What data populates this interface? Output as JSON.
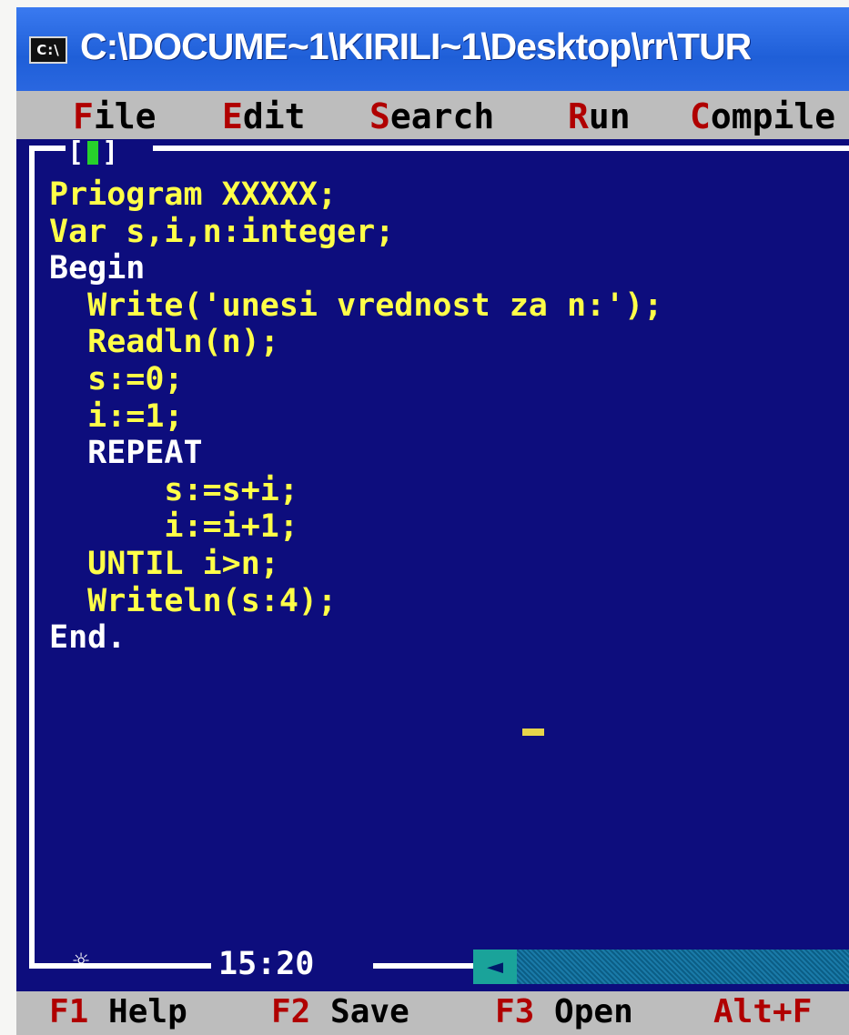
{
  "window": {
    "title": "C:\\DOCUME~1\\KIRILI~1\\Desktop\\rr\\TUR",
    "icon_text": "C:\\"
  },
  "menu": [
    {
      "hotkey": "F",
      "rest": "ile"
    },
    {
      "hotkey": "E",
      "rest": "dit"
    },
    {
      "hotkey": "S",
      "rest": "earch"
    },
    {
      "hotkey": "R",
      "rest": "un"
    },
    {
      "hotkey": "C",
      "rest": "ompile"
    }
  ],
  "editor": {
    "close_box_left": "[",
    "close_box_right": "]",
    "code_lines": [
      "Priogram XXXXX;",
      "Var s,i,n:integer;",
      "Begin",
      "  Write('unesi vrednost za n:');",
      "  Readln(n);",
      "  s:=0;",
      "  i:=1;",
      "  REPEAT",
      "      s:=s+i;",
      "      i:=i+1;",
      "  UNTIL i>n;",
      "  Writeln(s:4);",
      "End."
    ],
    "modified_marker": "☼",
    "cursor_position": "15:20"
  },
  "statusbar": [
    {
      "key": "F1",
      "label": "Help"
    },
    {
      "key": "F2",
      "label": "Save"
    },
    {
      "key": "F3",
      "label": "Open"
    },
    {
      "key": "Alt+F",
      "label": ""
    }
  ],
  "colors": {
    "background": "#0d0d7d",
    "code_text": "#ffff48",
    "menu_bg": "#bdbdbd",
    "hotkey": "#b00000",
    "titlebar": "#1f5fd8"
  }
}
